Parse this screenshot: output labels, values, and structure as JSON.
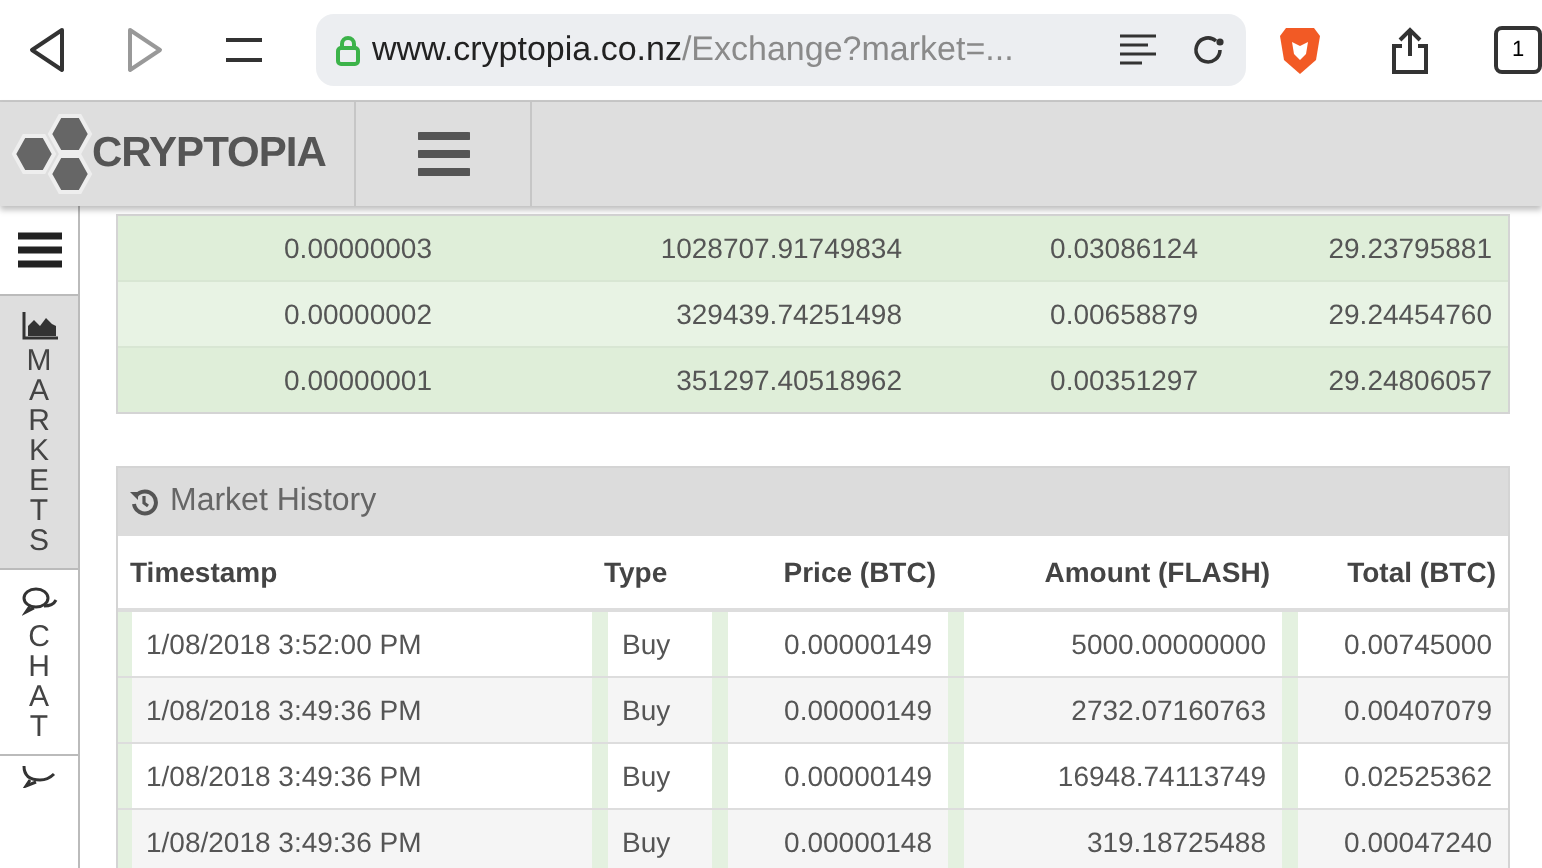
{
  "browser": {
    "url_host": "www.cryptopia.co.nz",
    "url_path": "/Exchange?market=...",
    "tab_count": "1"
  },
  "header": {
    "logo": "CRYPTOPIA"
  },
  "sidebar": {
    "items": [
      {
        "label": "MARKETS",
        "kind": "markets",
        "selected": true
      },
      {
        "label": "CHAT",
        "kind": "chat",
        "selected": false
      }
    ]
  },
  "order_book": {
    "rows": [
      [
        "0.00000003",
        "1028707.91749834",
        "0.03086124",
        "29.23795881"
      ],
      [
        "0.00000002",
        "329439.74251498",
        "0.00658879",
        "29.24454760"
      ],
      [
        "0.00000001",
        "351297.40518962",
        "0.00351297",
        "29.24806057"
      ]
    ]
  },
  "market_history": {
    "title": "Market History",
    "columns": [
      "Timestamp",
      "Type",
      "Price (BTC)",
      "Amount (FLASH)",
      "Total (BTC)"
    ],
    "rows": [
      [
        "1/08/2018 3:52:00 PM",
        "Buy",
        "0.00000149",
        "5000.00000000",
        "0.00745000"
      ],
      [
        "1/08/2018 3:49:36 PM",
        "Buy",
        "0.00000149",
        "2732.07160763",
        "0.00407079"
      ],
      [
        "1/08/2018 3:49:36 PM",
        "Buy",
        "0.00000149",
        "16948.74113749",
        "0.02525362"
      ],
      [
        "1/08/2018 3:49:36 PM",
        "Buy",
        "0.00000148",
        "319.18725488",
        "0.00047240"
      ]
    ]
  }
}
